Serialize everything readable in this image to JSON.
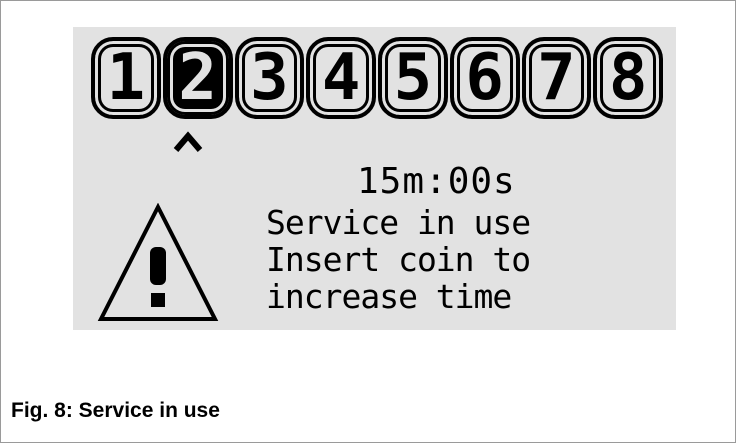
{
  "display": {
    "slots": [
      "1",
      "2",
      "3",
      "4",
      "5",
      "6",
      "7",
      "8"
    ],
    "selected_slot": "2",
    "timer": "15m:00s",
    "message_lines": [
      "Service in use",
      "Insert coin to",
      "increase time"
    ]
  },
  "icons": {
    "selector": "caret-up-icon",
    "alert": "warning-triangle-icon"
  },
  "caption": "Fig. 8: Service in use",
  "colors": {
    "lcd_background": "#e2e2e2",
    "foreground": "#000000",
    "page_background": "#ffffff"
  }
}
